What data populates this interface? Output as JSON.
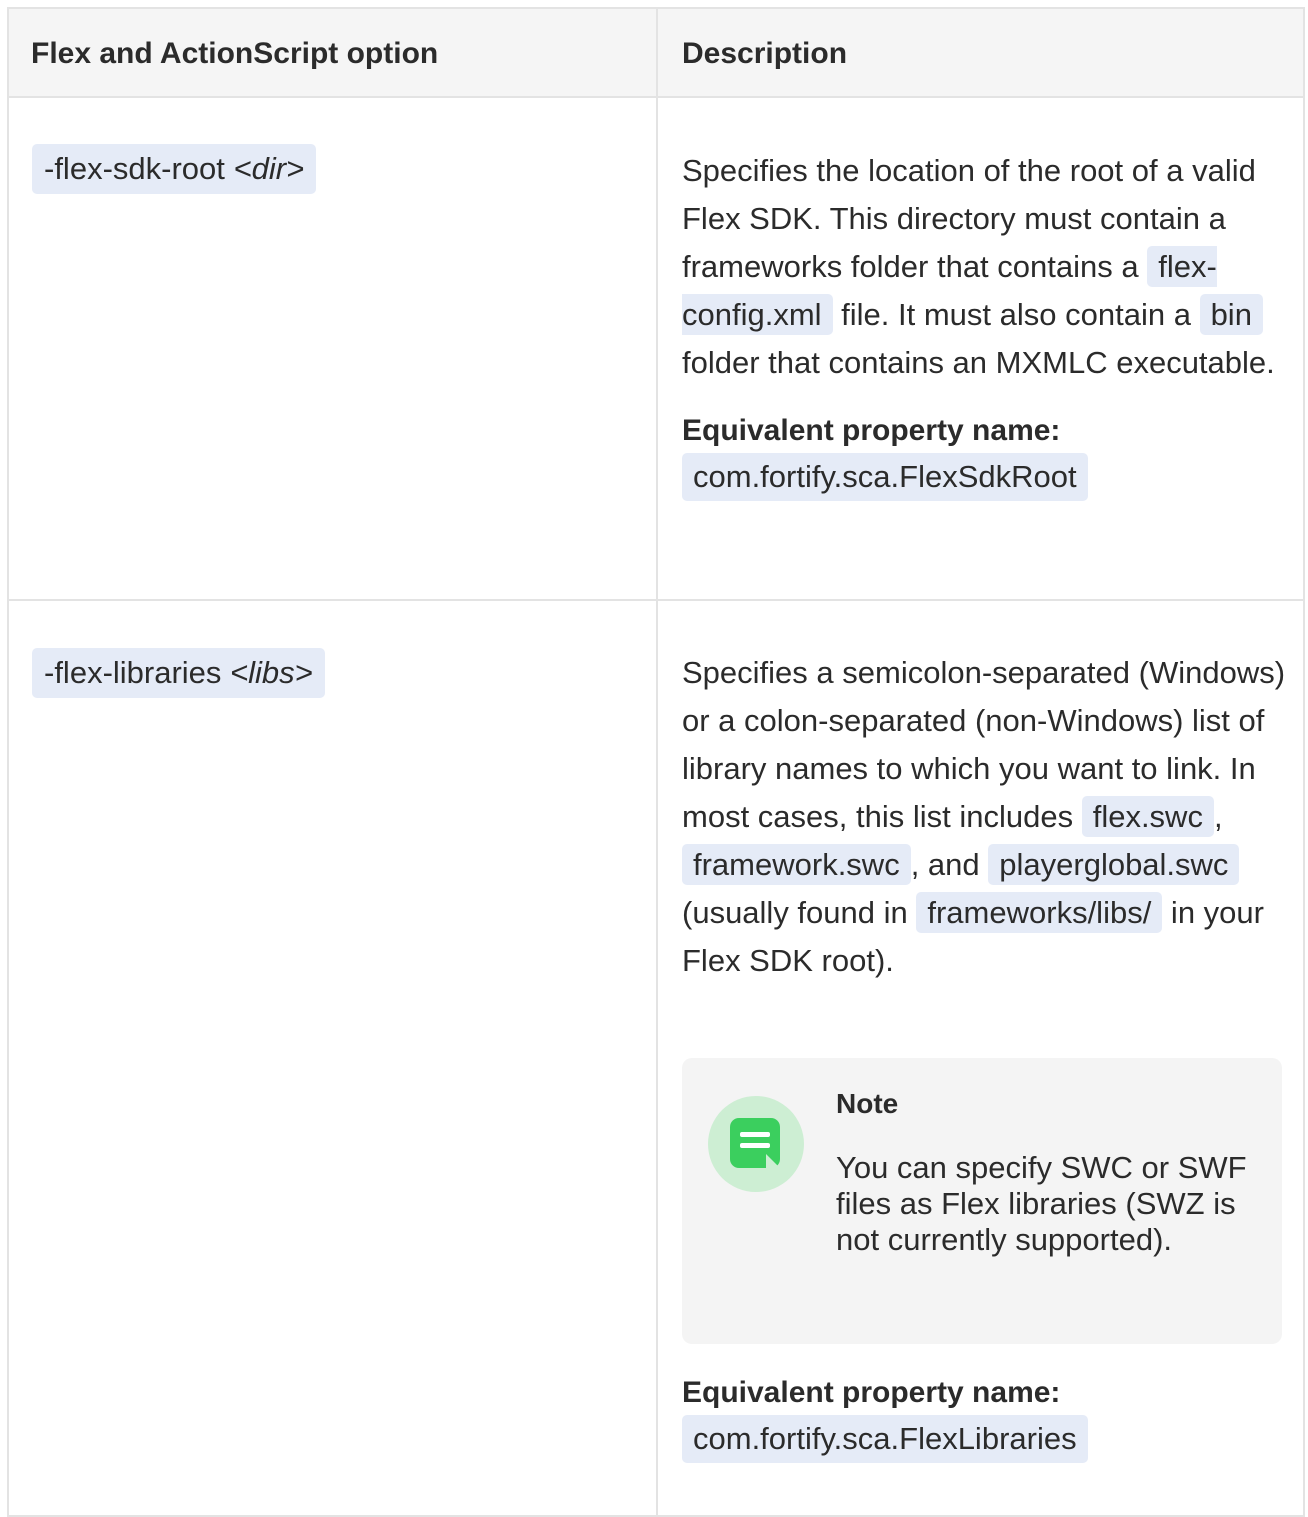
{
  "table": {
    "headers": [
      "Flex and ActionScript option",
      "Description"
    ],
    "rows": [
      {
        "option": "-flex-sdk-root",
        "arg": "<dir>",
        "desc_parts": [
          "Specifies the location of the root of a valid Flex SDK. This directory must contain a frameworks folder that contains a ",
          "flex-config.xml",
          " file. It must also contain a ",
          "bin",
          " folder that contains an MXMLC executable."
        ],
        "equiv_label": "Equivalent property name:",
        "equiv_value": "com.fortify.sca.FlexSdkRoot"
      },
      {
        "option": "-flex-libraries",
        "arg": "<libs>",
        "desc_parts": [
          "Specifies a semicolon-separated (Windows) or a colon-separated (non-Windows) list of library names to which you want to link. In most cases, this list includes ",
          "flex.swc",
          ", ",
          "framework.swc",
          ", and ",
          "playerglobal.swc",
          " (usually found in ",
          "frameworks/libs/",
          " in your Flex SDK root)."
        ],
        "note": {
          "icon": "note-icon",
          "title": "Note",
          "text": "You can specify SWC or SWF files as Flex libraries (SWZ is not currently supported)."
        },
        "equiv_label": "Equivalent property name:",
        "equiv_value": "com.fortify.sca.FlexLibraries"
      }
    ]
  },
  "colors": {
    "code_bg": "#e5ebf7",
    "header_bg": "#f5f5f5",
    "note_bg": "#f4f4f4",
    "note_icon": "#3bcf5e"
  }
}
